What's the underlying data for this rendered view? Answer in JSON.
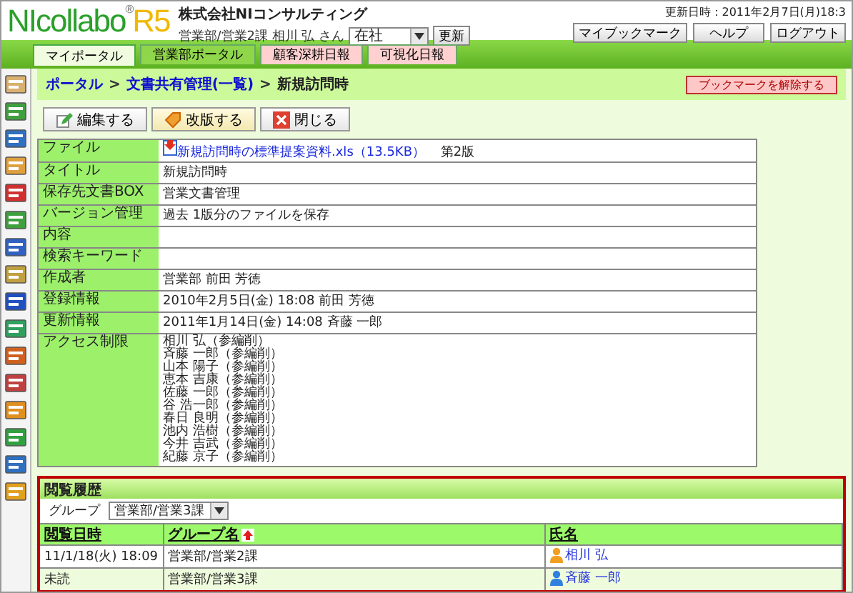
{
  "header": {
    "logo_main": "NIcollabo",
    "logo_mark": "®",
    "logo_version": "R5",
    "company": "株式会社NIコンサルティング",
    "user": "営業部/営業2課 相川 弘 さん",
    "status_select": "在社",
    "refresh_button": "更新",
    "updated": "更新日時：2011年2月7日(月)18:3",
    "buttons": [
      "マイブックマーク",
      "ヘルプ",
      "ログアウト"
    ]
  },
  "tabs": [
    {
      "label": "マイポータル",
      "selected": true,
      "color": "#f0fbe0"
    },
    {
      "label": "営業部ポータル",
      "selected": false,
      "color": "#8fd64a"
    },
    {
      "label": "顧客深耕日報",
      "selected": false,
      "color": "#ffd0d0"
    },
    {
      "label": "可視化日報",
      "selected": false,
      "color": "#ffd0d0"
    }
  ],
  "breadcrumb": {
    "links": [
      "ポータル",
      "文書共有管理(一覧)"
    ],
    "separator": ">",
    "current": "新規訪問時",
    "bookmark_button": "ブックマークを解除する"
  },
  "toolbar": [
    {
      "label": "編集する",
      "kind": "edit",
      "selected": false
    },
    {
      "label": "改版する",
      "kind": "revise",
      "selected": true
    },
    {
      "label": "閉じる",
      "kind": "close",
      "selected": false
    }
  ],
  "details": [
    {
      "label": "ファイル",
      "kind": "file",
      "link": "新規訪問時の標準提案資料.xls（13.5KB）",
      "value": "第2版"
    },
    {
      "label": "タイトル",
      "value": "新規訪問時"
    },
    {
      "label": "保存先文書BOX",
      "value": "営業文書管理"
    },
    {
      "label": "バージョン管理",
      "value": "過去 1版分のファイルを保存"
    },
    {
      "label": "内容"
    },
    {
      "label": "検索キーワード"
    },
    {
      "label": "作成者",
      "value": "営業部  前田 芳徳"
    },
    {
      "label": "登録情報",
      "value": "2010年2月5日(金) 18:08  前田 芳徳"
    },
    {
      "label": "更新情報",
      "value": "2011年1月14日(金) 14:08  斉藤 一郎"
    },
    {
      "label": "アクセス制限",
      "kind": "list",
      "lines": [
        "相川 弘（参編削）",
        "斉藤 一郎（参編削）",
        "山本 陽子（参編削）",
        "恵本 吉康（参編削）",
        "佐藤 一郎（参編削）",
        "谷 浩一郎（参編削）",
        "春日 良明（参編削）",
        "池内 浩樹（参編削）",
        "今井 吉武（参編削）",
        "紀藤 京子（参編削）"
      ]
    }
  ],
  "history": {
    "title": "閲覧履歴",
    "group_label": "グループ",
    "group_select": "営業部/営業3課",
    "columns": [
      "閲覧日時",
      "グループ名",
      "氏名"
    ],
    "rows": [
      {
        "date": "11/1/18(火) 18:09",
        "group": "営業部/営業2課",
        "name": "相川 弘",
        "color": "#f0a020"
      },
      {
        "date": "未読",
        "group": "営業部/営業3課",
        "name": "斉藤 一郎",
        "color": "#3080e0"
      }
    ]
  }
}
